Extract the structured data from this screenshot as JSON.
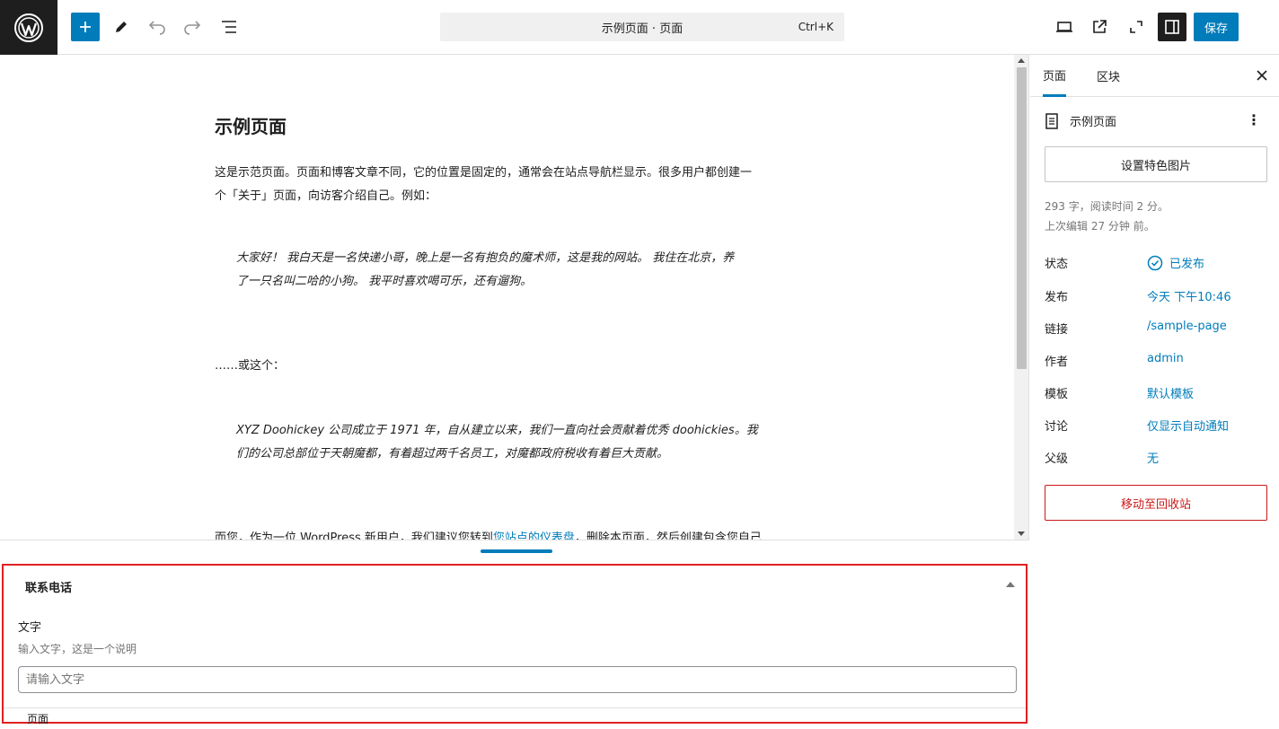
{
  "toolbar": {
    "command_title": "示例页面 · 页面",
    "command_shortcut": "Ctrl+K",
    "save_label": "保存"
  },
  "post": {
    "title": "示例页面",
    "para1_line1": "这是示范页面。页面和博客文章不同，它的位置是固定的，通常会在站点导航栏显示。很多用户都创建一",
    "para1_line2": "个「关于」页面，向访客介绍自己。例如：",
    "quote1_line1": "大家好！ 我白天是一名快递小哥，晚上是一名有抱负的魔术师，这是我的网站。 我住在北京，养",
    "quote1_line2": "了一只名叫二哈的小狗。 我平时喜欢喝可乐，还有遛狗。",
    "para2": "……或这个：",
    "quote2_line1": "XYZ Doohickey 公司成立于 1971 年，自从建立以来，我们一直向社会贡献着优秀 doohickies。我",
    "quote2_line2": "们的公司总部位于天朝魔都，有着超过两千名员工，对魔都政府税收有着巨大贡献。",
    "para3_start": "而您，作为一位 WordPress 新用户，我们建议您转到",
    "para3_link": "您站点的仪表盘",
    "para3_end": "，删除本页面，然后创建包含您自己"
  },
  "metabox": {
    "title": "联系电话",
    "field_label": "文字",
    "field_desc": "输入文字，这是一个说明",
    "field_placeholder": "请输入文字",
    "next_label": "页面"
  },
  "sidebar": {
    "tab_page": "页面",
    "tab_block": "区块",
    "doc_title": "示例页面",
    "featured_image": "设置特色图片",
    "stats_line1": "293 字，阅读时间 2 分。",
    "stats_line2": "上次编辑 27 分钟 前。",
    "rows": [
      {
        "label": "状态",
        "value": "已发布"
      },
      {
        "label": "发布",
        "value": "今天 下午10:46"
      },
      {
        "label": "链接",
        "value": "/sample-page"
      },
      {
        "label": "作者",
        "value": "admin"
      },
      {
        "label": "模板",
        "value": "默认模板"
      },
      {
        "label": "讨论",
        "value": "仅显示自动通知"
      },
      {
        "label": "父级",
        "value": "无"
      }
    ],
    "trash": "移动至回收站"
  },
  "colors": {
    "accent": "#007cba",
    "dark": "#1e1e1e",
    "danger": "#cc1818",
    "highlight_border": "#e02020"
  }
}
